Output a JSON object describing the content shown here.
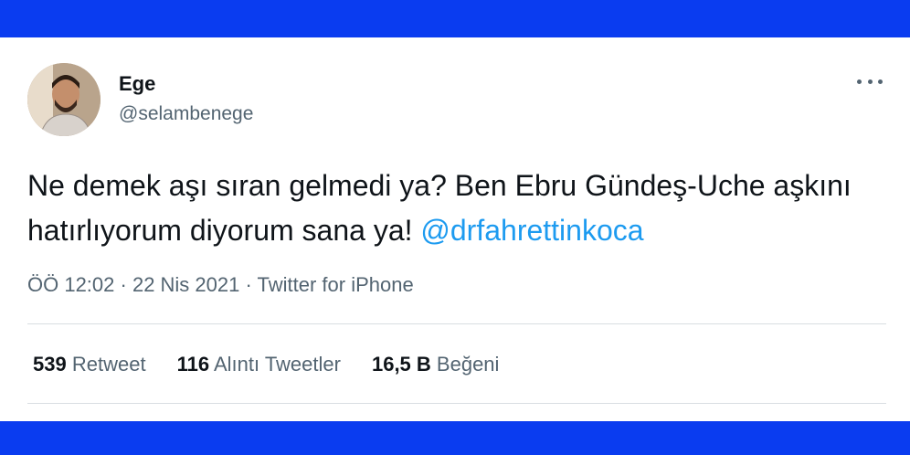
{
  "user": {
    "name": "Ege",
    "handle": "@selambenege"
  },
  "tweet": {
    "text_part1": "Ne demek aşı sıran gelmedi ya? Ben Ebru Gündeş-Uche aşkını hatırlıyorum diyorum sana ya! ",
    "mention": "@drfahrettinkoca"
  },
  "meta": {
    "time": "ÖÖ 12:02",
    "sep1": " · ",
    "date": "22 Nis 2021",
    "sep2": " · ",
    "source": "Twitter for iPhone"
  },
  "stats": [
    {
      "count": "539",
      "label": "Retweet"
    },
    {
      "count": "116",
      "label": "Alıntı Tweetler"
    },
    {
      "count": "16,5 B",
      "label": "Beğeni"
    }
  ],
  "colors": {
    "frame": "#0a3cf0",
    "mention": "#1d9bf0",
    "secondary_text": "#536471"
  },
  "icons": {
    "more": "more-horizontal-icon"
  }
}
